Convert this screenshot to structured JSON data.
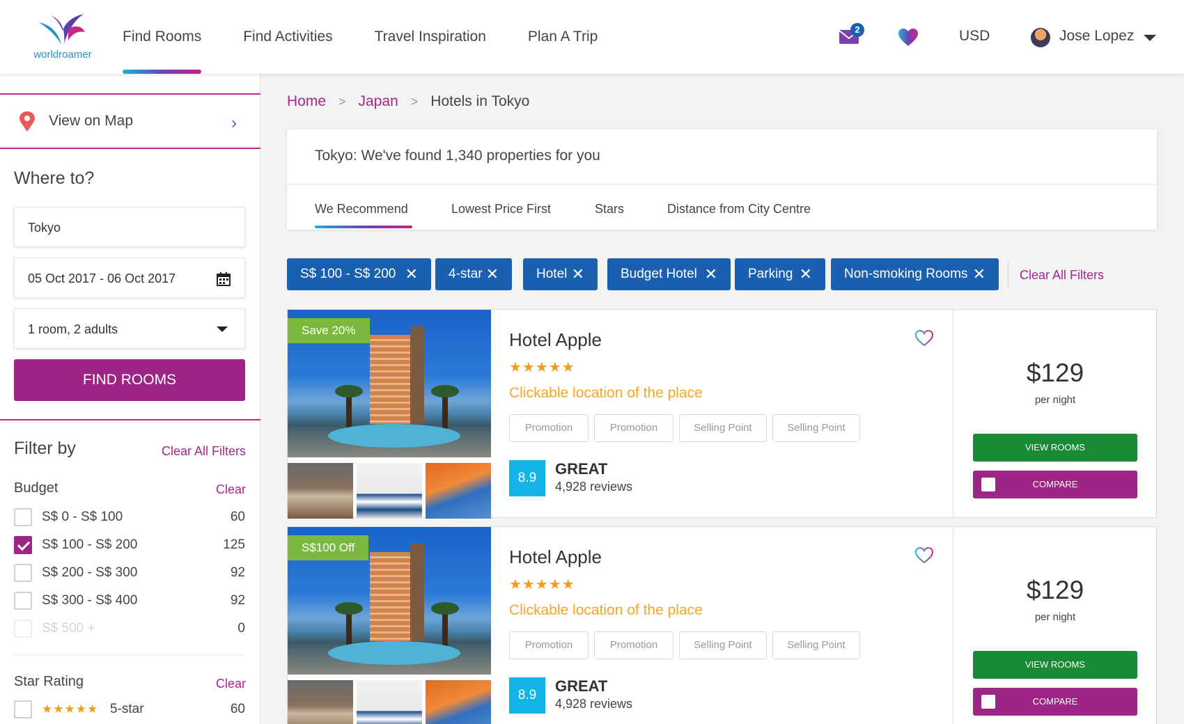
{
  "header": {
    "logo_text": "worldroamer",
    "nav": [
      {
        "label": "Find Rooms",
        "active": true
      },
      {
        "label": "Find Activities"
      },
      {
        "label": "Travel Inspiration"
      },
      {
        "label": "Plan A Trip"
      }
    ],
    "mail_badge": "2",
    "currency": "USD",
    "user_name": "Jose Lopez",
    "icons": [
      "logo",
      "mail-icon",
      "heart-icon",
      "avatar",
      "chevron-down-icon"
    ]
  },
  "sidebar": {
    "view_on_map": "View on Map",
    "where_title": "Where to?",
    "destination_value": "Tokyo",
    "dates_value": "05 Oct 2017 - 06 Oct 2017",
    "guests_value": "1 room, 2 adults",
    "find_button": "FIND ROOMS",
    "filter_title": "Filter by",
    "clear_all": "Clear All Filters",
    "budget": {
      "title": "Budget",
      "clear": "Clear",
      "options": [
        {
          "label": "S$ 0 - S$ 100",
          "count": "60",
          "checked": false
        },
        {
          "label": "S$ 100 - S$ 200",
          "count": "125",
          "checked": true
        },
        {
          "label": "S$ 200 - S$ 300",
          "count": "92",
          "checked": false
        },
        {
          "label": "S$ 300 - S$ 400",
          "count": "92",
          "checked": false
        },
        {
          "label": "S$ 500 +",
          "count": "0",
          "checked": false,
          "disabled": true
        }
      ]
    },
    "star_rating": {
      "title": "Star Rating",
      "clear": "Clear",
      "options": [
        {
          "stars": "★★★★★",
          "label": "5-star",
          "count": "60",
          "checked": false
        }
      ]
    }
  },
  "main": {
    "breadcrumb": {
      "home": "Home",
      "country": "Japan",
      "current": "Hotels in Tokyo",
      "separator": ">"
    },
    "results_text": "Tokyo: We've found 1,340 properties for you",
    "sort_tabs": [
      {
        "label": "We Recommend",
        "active": true
      },
      {
        "label": "Lowest Price First"
      },
      {
        "label": "Stars"
      },
      {
        "label": "Distance from City Centre"
      }
    ],
    "chips": [
      {
        "label": "S$ 100 - S$ 200"
      },
      {
        "label": "4-star"
      },
      {
        "label": "Hotel"
      },
      {
        "label": "Budget Hotel"
      },
      {
        "label": "Parking"
      },
      {
        "label": "Non-smoking Rooms"
      }
    ],
    "chip_close_symbol": "✕",
    "chips_clear": "Clear All Filters",
    "hotels": [
      {
        "badge": "Save 20%",
        "name": "Hotel Apple",
        "stars": "★★★★★",
        "location": "Clickable location of the place",
        "tags": [
          "Promotion",
          "Promotion",
          "Selling Point",
          "Selling Point"
        ],
        "score": "8.9",
        "rating_word": "GREAT",
        "reviews": "4,928 reviews",
        "price": "$129",
        "per_night": "per night",
        "view_rooms": "VIEW ROOMS",
        "compare": "COMPARE"
      },
      {
        "badge": "S$100 Off",
        "name": "Hotel Apple",
        "stars": "★★★★★",
        "location": "Clickable location of the place",
        "tags": [
          "Promotion",
          "Promotion",
          "Selling Point",
          "Selling Point"
        ],
        "score": "8.9",
        "rating_word": "GREAT",
        "reviews": "4,928 reviews",
        "price": "$129",
        "per_night": "per night",
        "view_rooms": "VIEW ROOMS",
        "compare": "COMPARE"
      }
    ]
  },
  "colors": {
    "brand_purple": "#9c2585",
    "link_purple": "#a3278f",
    "chip_blue": "#1a5fb0",
    "score_blue": "#12b4e8",
    "view_green": "#178a35",
    "save_badge_green": "#7bb93e",
    "location_orange": "#f5a623",
    "star_orange": "#f29b1d"
  }
}
